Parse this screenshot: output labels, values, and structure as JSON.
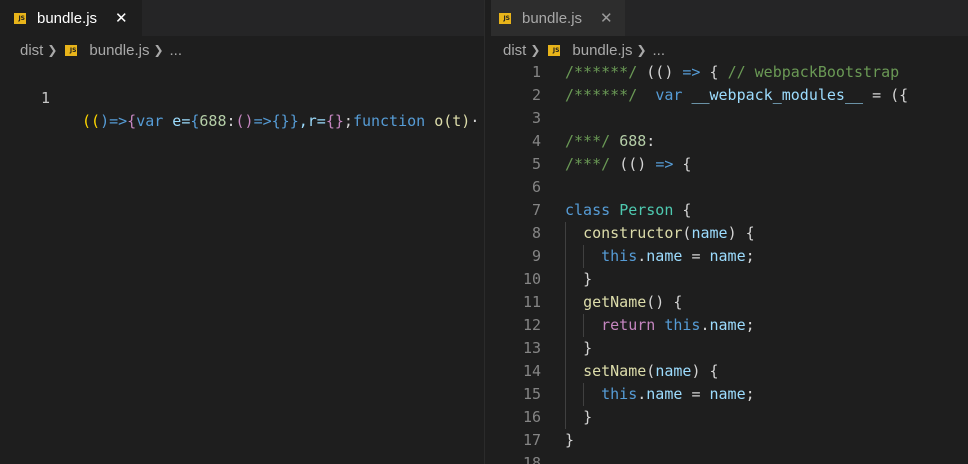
{
  "left": {
    "tab": {
      "icon": "JS",
      "label": "bundle.js",
      "close": "✕"
    },
    "breadcrumb": {
      "folder": "dist",
      "icon": "JS",
      "file": "bundle.js",
      "more": "..."
    },
    "line_number": "1",
    "tokens": [
      "((",
      ")=>",
      "{",
      "var",
      " e=",
      "{",
      "688",
      ":",
      "()",
      "=>",
      "{}",
      "}",
      ",r=",
      "{}",
      ";",
      "function",
      " o(t)",
      "·"
    ]
  },
  "right": {
    "tab": {
      "icon": "JS",
      "label": "bundle.js",
      "close": "✕"
    },
    "breadcrumb": {
      "folder": "dist",
      "icon": "JS",
      "file": "bundle.js",
      "more": "..."
    },
    "lines": [
      {
        "n": "1",
        "t": [
          "/******/",
          " ",
          "(()",
          " ",
          "=>",
          " ",
          "{",
          " ",
          "// webpackBootstrap"
        ]
      },
      {
        "n": "2",
        "t": [
          "/******/",
          "  ",
          "var",
          " ",
          "__webpack_modules__",
          " ",
          "=",
          " ",
          "({"
        ]
      },
      {
        "n": "3",
        "t": []
      },
      {
        "n": "4",
        "t": [
          "/***/",
          " ",
          "688",
          ":"
        ]
      },
      {
        "n": "5",
        "t": [
          "/***/",
          " ",
          "(()",
          " ",
          "=>",
          " ",
          "{"
        ]
      },
      {
        "n": "6",
        "t": []
      },
      {
        "n": "7",
        "t": [
          "class",
          " ",
          "Person",
          " ",
          "{"
        ]
      },
      {
        "n": "8",
        "t": [
          "  ",
          "constructor",
          "(",
          "name",
          ")",
          " ",
          "{"
        ]
      },
      {
        "n": "9",
        "t": [
          "    ",
          "this",
          ".",
          "name",
          " ",
          "=",
          " ",
          "name",
          ";"
        ]
      },
      {
        "n": "10",
        "t": [
          "  ",
          "}"
        ]
      },
      {
        "n": "11",
        "t": [
          "  ",
          "getName",
          "()",
          " ",
          "{"
        ]
      },
      {
        "n": "12",
        "t": [
          "    ",
          "return",
          " ",
          "this",
          ".",
          "name",
          ";"
        ]
      },
      {
        "n": "13",
        "t": [
          "  ",
          "}"
        ]
      },
      {
        "n": "14",
        "t": [
          "  ",
          "setName",
          "(",
          "name",
          ")",
          " ",
          "{"
        ]
      },
      {
        "n": "15",
        "t": [
          "    ",
          "this",
          ".",
          "name",
          " ",
          "=",
          " ",
          "name",
          ";"
        ]
      },
      {
        "n": "16",
        "t": [
          "  ",
          "}"
        ]
      },
      {
        "n": "17",
        "t": [
          "}"
        ]
      },
      {
        "n": "18",
        "t": []
      }
    ]
  },
  "colors": {
    "background": "#1e1e1e",
    "tabbar": "#252526",
    "comment": "#6a9955",
    "keyword": "#569cd6",
    "control": "#c586c0",
    "variable": "#9cdcfe",
    "function": "#dcdcaa",
    "class": "#4ec9b0",
    "number": "#b5cea8",
    "bracket": "#ffd700",
    "jsIcon": "#e8b41a"
  }
}
